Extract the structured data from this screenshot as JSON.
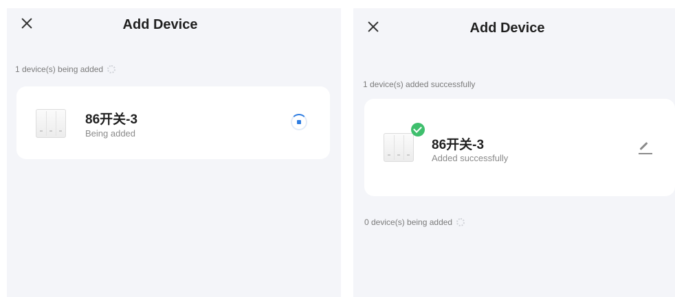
{
  "left_screen": {
    "title": "Add Device",
    "close_icon": "close-icon",
    "adding_status": "1 device(s) being added",
    "device": {
      "name": "86开关-3",
      "status": "Being added",
      "state_icon": "loading-icon"
    }
  },
  "right_screen": {
    "title": "Add Device",
    "close_icon": "close-icon",
    "success_status": "1 device(s) added successfully",
    "device": {
      "name": "86开关-3",
      "status": "Added successfully",
      "badge_icon": "check-icon",
      "edit_icon": "edit-icon"
    },
    "adding_status": "0 device(s) being added"
  },
  "colors": {
    "background": "#f4f5f9",
    "card": "#ffffff",
    "accent_blue": "#2f7de1",
    "success_green": "#3fbf6d"
  }
}
